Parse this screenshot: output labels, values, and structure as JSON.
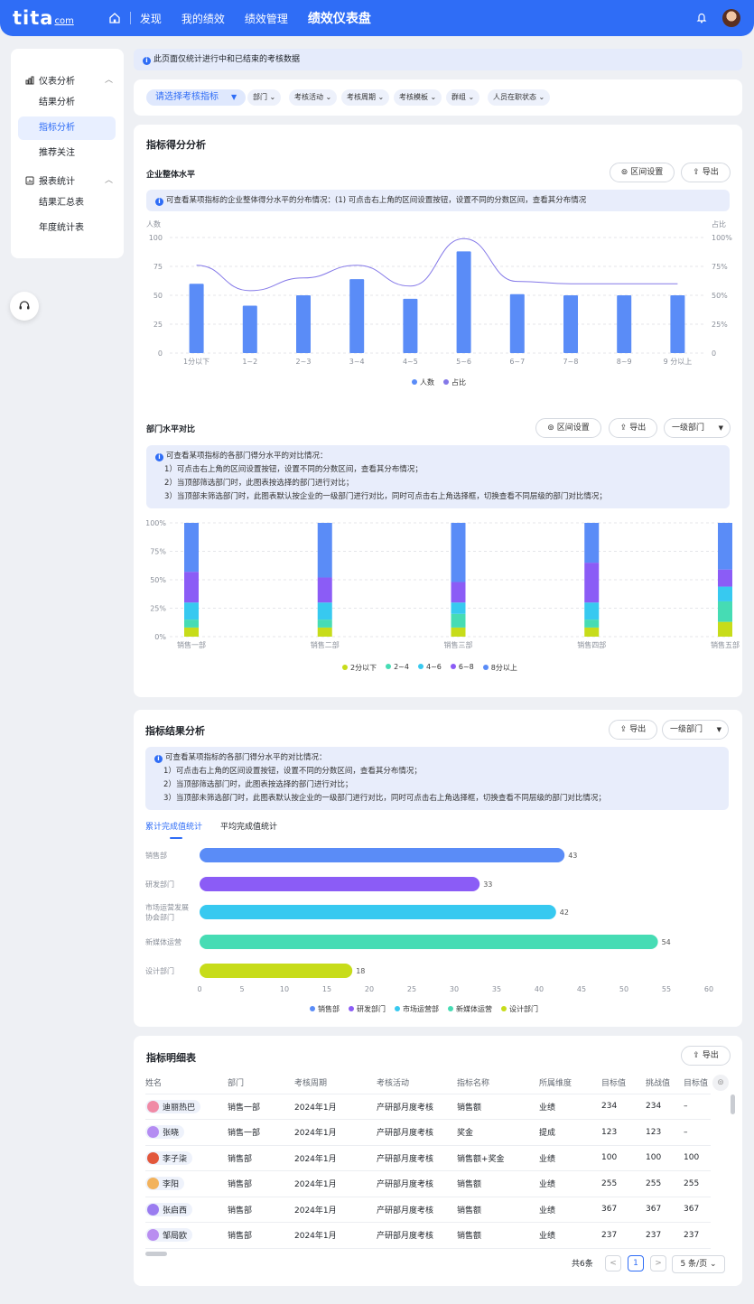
{
  "topbar": {
    "logo_main": "tita",
    "logo_sub": "com",
    "nav": [
      {
        "label": "发现"
      },
      {
        "label": "我的绩效"
      },
      {
        "label": "绩效管理"
      },
      {
        "label": "绩效仪表盘"
      }
    ]
  },
  "sidebar": {
    "groups": [
      {
        "label": "仪表分析",
        "items": [
          {
            "label": "结果分析"
          },
          {
            "label": "指标分析"
          },
          {
            "label": "推荐关注"
          }
        ]
      },
      {
        "label": "报表统计",
        "items": [
          {
            "label": "结果汇总表"
          },
          {
            "label": "年度统计表"
          }
        ]
      }
    ]
  },
  "notice": "此页面仅统计进行中和已结束的考核数据",
  "filters": {
    "main": "请选择考核指标",
    "others": [
      "部门",
      "考核活动",
      "考核周期",
      "考核模板",
      "群组",
      "人员在职状态"
    ]
  },
  "section1": {
    "title": "指标得分分析",
    "overall": {
      "subtitle": "企业整体水平",
      "btn_range": "区间设置",
      "btn_export": "导出",
      "info": "可查看某项指标的企业整体得分水平的分布情况：(1) 可点击右上角的区间设置按钮，设置不同的分数区间，查看其分布情况"
    },
    "dept": {
      "subtitle": "部门水平对比",
      "btn_range": "区间设置",
      "btn_export": "导出",
      "select": "一级部门",
      "info": [
        "可查看某项指标的各部门得分水平的对比情况：",
        "1）可点击右上角的区间设置按钮，设置不同的分数区间，查看其分布情况；",
        "2）当顶部筛选部门时，此图表按选择的部门进行对比；",
        "3）当顶部未筛选部门时，此图表默认按企业的一级部门进行对比，同时可点击右上角选择框，切换查看不同层级的部门对比情况；"
      ]
    }
  },
  "section2": {
    "title": "指标结果分析",
    "btn_export": "导出",
    "select": "一级部门",
    "info": [
      "可查看某项指标的各部门得分水平的对比情况：",
      "1）可点击右上角的区间设置按钮，设置不同的分数区间，查看其分布情况；",
      "2）当顶部筛选部门时，此图表按选择的部门进行对比；",
      "3）当顶部未筛选部门时，此图表默认按企业的一级部门进行对比，同时可点击右上角选择框，切换查看不同层级的部门对比情况；"
    ],
    "tabs": [
      "累计完成值统计",
      "平均完成值统计"
    ]
  },
  "section3": {
    "title": "指标明细表",
    "btn_export": "导出",
    "columns": [
      "姓名",
      "部门",
      "考核周期",
      "考核活动",
      "指标名称",
      "所属维度",
      "目标值",
      "挑战值",
      "目标值"
    ],
    "rows": [
      {
        "name": "迪丽热巴",
        "dept": "销售一部",
        "period": "2024年1月",
        "activity": "产研部月度考核",
        "metric": "销售额",
        "dim": "业绩",
        "target": "234",
        "challenge": "234",
        "target2": "–",
        "color": "#f08aa6"
      },
      {
        "name": "张晓",
        "dept": "销售一部",
        "period": "2024年1月",
        "activity": "产研部月度考核",
        "metric": "奖金",
        "dim": "提成",
        "target": "123",
        "challenge": "123",
        "target2": "–",
        "color": "#b48cf2"
      },
      {
        "name": "李子柒",
        "dept": "销售部",
        "period": "2024年1月",
        "activity": "产研部月度考核",
        "metric": "销售额+奖金",
        "dim": "业绩",
        "target": "100",
        "challenge": "100",
        "target2": "100",
        "color": "#e2573b"
      },
      {
        "name": "李阳",
        "dept": "销售部",
        "period": "2024年1月",
        "activity": "产研部月度考核",
        "metric": "销售额",
        "dim": "业绩",
        "target": "255",
        "challenge": "255",
        "target2": "255",
        "color": "#f2b25c"
      },
      {
        "name": "张启西",
        "dept": "销售部",
        "period": "2024年1月",
        "activity": "产研部月度考核",
        "metric": "销售额",
        "dim": "业绩",
        "target": "367",
        "challenge": "367",
        "target2": "367",
        "color": "#9a7cf0"
      },
      {
        "name": "邹局欧",
        "dept": "销售部",
        "period": "2024年1月",
        "activity": "产研部月度考核",
        "metric": "销售额",
        "dim": "业绩",
        "target": "237",
        "challenge": "237",
        "target2": "237",
        "color": "#b98ef0"
      }
    ],
    "pager": {
      "total": "共6条",
      "page": "1",
      "size": "5 条/页"
    }
  },
  "chart_data": [
    {
      "type": "bar",
      "categories": [
        "1分以下",
        "1~2",
        "2~3",
        "3~4",
        "4~5",
        "5~6",
        "6~7",
        "7~8",
        "8~9",
        "9 分以上"
      ],
      "series": [
        {
          "name": "人数",
          "type": "bar",
          "axis": "left",
          "color": "#5a8cf7",
          "values": [
            60,
            41,
            50,
            64,
            47,
            88,
            51,
            50,
            50,
            50
          ]
        },
        {
          "name": "占比",
          "type": "line",
          "axis": "right",
          "color": "#8478e8",
          "values": [
            76,
            54,
            65,
            76,
            58,
            99,
            62,
            60,
            60,
            60
          ]
        }
      ],
      "ylabel": "人数",
      "y2label": "占比",
      "ylim": [
        0,
        100
      ],
      "yticks": [
        "0",
        "25",
        "50",
        "75",
        "100"
      ],
      "y2ticks": [
        "0",
        "25%",
        "50%",
        "75%",
        "100%"
      ],
      "legend": "bottom"
    },
    {
      "type": "bar",
      "stacked": true,
      "categories": [
        "销售一部",
        "销售二部",
        "销售三部",
        "销售四部",
        "销售五部"
      ],
      "series": [
        {
          "name": "2分以下",
          "color": "#c7dc1a",
          "values": [
            8,
            8,
            8,
            8,
            13
          ]
        },
        {
          "name": "2~4",
          "color": "#46dcb4",
          "values": [
            7,
            7,
            12,
            7,
            18
          ]
        },
        {
          "name": "4~6",
          "color": "#37c9f0",
          "values": [
            15,
            15,
            10,
            15,
            13
          ]
        },
        {
          "name": "6~8",
          "color": "#8b5cf6",
          "values": [
            27,
            22,
            18,
            35,
            15
          ]
        },
        {
          "name": "8分以上",
          "color": "#5a8cf7",
          "values": [
            43,
            48,
            52,
            35,
            41
          ]
        }
      ],
      "yticks": [
        "0%",
        "25%",
        "50%",
        "75%",
        "100%"
      ],
      "legend": "bottom"
    },
    {
      "type": "bar",
      "orientation": "horizontal",
      "categories": [
        "销售部",
        "研发部门",
        "市场运营发展协会部门",
        "新媒体运营",
        "设计部门"
      ],
      "values": [
        43,
        33,
        42,
        54,
        18
      ],
      "colors": [
        "#5a8cf7",
        "#8b5cf6",
        "#37c9f0",
        "#46dcb4",
        "#c7dc1a"
      ],
      "xlim": [
        0,
        60
      ],
      "xticks": [
        "0",
        "5",
        "10",
        "15",
        "20",
        "25",
        "30",
        "35",
        "40",
        "45",
        "50",
        "55",
        "60"
      ],
      "legend_labels": [
        "销售部",
        "研发部门",
        "市场运营部",
        "新媒体运营",
        "设计部门"
      ],
      "legend": "bottom"
    }
  ]
}
